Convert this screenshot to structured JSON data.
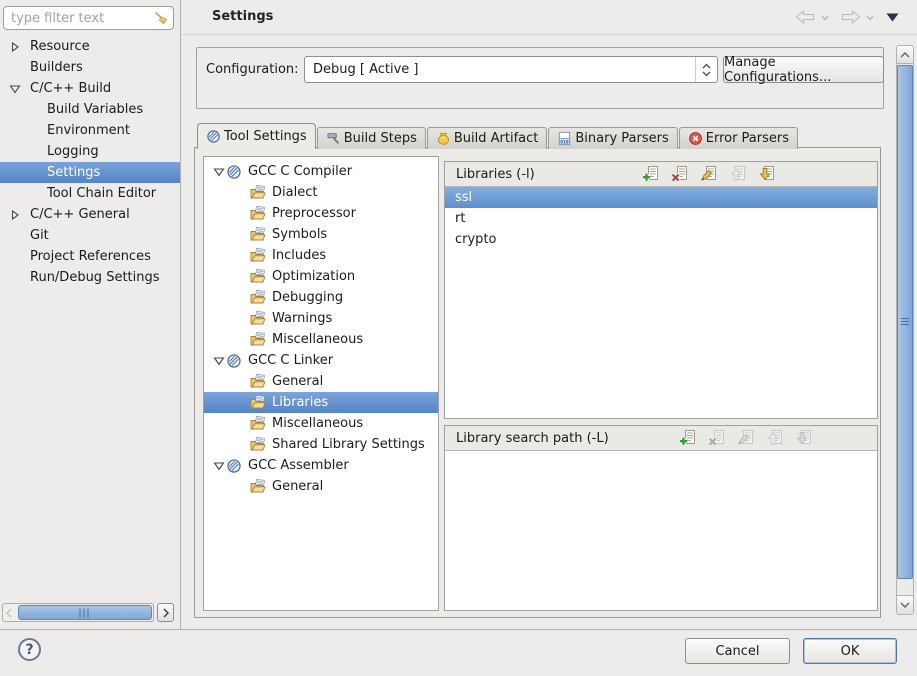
{
  "header": {
    "title": "Settings"
  },
  "sidebar": {
    "filter_placeholder": "type filter text",
    "items": [
      "Resource",
      "Builders",
      "C/C++ Build",
      "Build Variables",
      "Environment",
      "Logging",
      "Settings",
      "Tool Chain Editor",
      "C/C++ General",
      "Git",
      "Project References",
      "Run/Debug Settings"
    ],
    "selected_item": "Settings"
  },
  "configuration": {
    "label": "Configuration:",
    "value": "Debug [ Active ]",
    "manage_label": "Manage Configurations..."
  },
  "tabs": {
    "labels": [
      "Tool Settings",
      "Build Steps",
      "Build Artifact",
      "Binary Parsers",
      "Error Parsers"
    ],
    "active": "Tool Settings",
    "icons": [
      "tool-icon",
      "hammer-icon",
      "artifact-icon",
      "binary-file-icon",
      "error-icon"
    ]
  },
  "tool_tree": {
    "items": [
      "GCC C Compiler",
      "Dialect",
      "Preprocessor",
      "Symbols",
      "Includes",
      "Optimization",
      "Debugging",
      "Warnings",
      "Miscellaneous",
      "GCC C Linker",
      "General",
      "Libraries",
      "Miscellaneous",
      "Shared Library Settings",
      "GCC Assembler",
      "General"
    ],
    "selected_item": "Libraries"
  },
  "libraries_panel": {
    "title": "Libraries (-l)",
    "items": [
      "ssl",
      "rt",
      "crypto"
    ],
    "selected_item": "ssl",
    "toolbar_icons": [
      "add-icon",
      "delete-icon",
      "edit-icon",
      "move-up-icon",
      "move-down-icon"
    ]
  },
  "search_path_panel": {
    "title": "Library search path (-L)",
    "items": [],
    "toolbar_icons": [
      "add-icon",
      "delete-icon",
      "edit-icon",
      "move-up-icon",
      "move-down-icon"
    ]
  },
  "footer": {
    "help_label": "?",
    "cancel_label": "Cancel",
    "ok_label": "OK"
  },
  "colors": {
    "selection_blue": "#5c8ecb",
    "tab_active_border": "#7094bf",
    "panel_border": "#a3a19d",
    "error_red": "#dd5650",
    "add_green": "#2f9e3f",
    "artifact_gold": "#f4c84e",
    "scroll_thumb_blue": "#7fa7d6"
  }
}
